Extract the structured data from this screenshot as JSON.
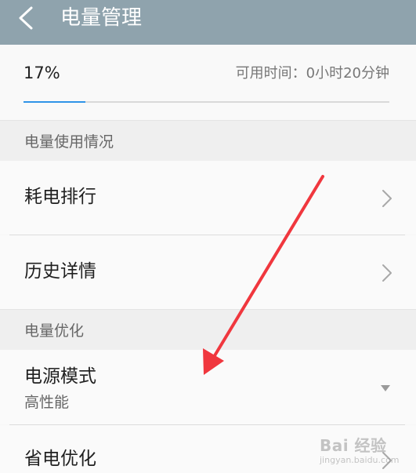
{
  "header": {
    "title": "电量管理",
    "icon": "back-arrow-icon"
  },
  "battery": {
    "percent_label": "17%",
    "level": 0.17,
    "available_time_label": "可用时间：0小时20分钟"
  },
  "sections": {
    "usage": {
      "title": "电量使用情况",
      "items": [
        {
          "label": "耗电排行",
          "icon": "chevron-right-icon"
        },
        {
          "label": "历史详情",
          "icon": "chevron-right-icon"
        }
      ]
    },
    "optimize": {
      "title": "电量优化",
      "power_mode": {
        "label": "电源模式",
        "value": "高性能",
        "icon": "dropdown-triangle-icon"
      },
      "save_power": {
        "label": "省电优化",
        "icon": "chevron-right-icon"
      }
    }
  },
  "annotation": {
    "color": "#f0373e",
    "icon": "red-arrow-annotation"
  },
  "watermark": {
    "text": "Bai 经验",
    "subtext": "jingyan.baidu.com"
  },
  "colors": {
    "header_bg": "#8fa3ad",
    "progress_fill": "#2f94e8",
    "progress_track": "#d9d9d9"
  }
}
